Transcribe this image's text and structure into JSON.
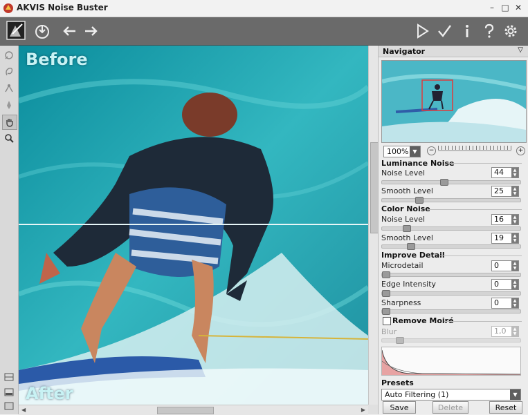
{
  "window": {
    "title": "AKVIS Noise Buster",
    "minimize": "–",
    "maximize": "□",
    "close": "✕"
  },
  "toolbar": {
    "left_icons": [
      "photo-icon",
      "save-icon",
      "undo-arrow-icon",
      "redo-arrow-icon"
    ],
    "right_icons": [
      "run-icon",
      "apply-check-icon",
      "info-icon",
      "help-icon",
      "settings-gear-icon"
    ]
  },
  "tools": [
    "crop-tool-icon",
    "lasso-tool-icon",
    "heal-tool-icon",
    "brush-tool-icon",
    "hand-tool-icon",
    "zoom-tool-icon"
  ],
  "canvas": {
    "before_label": "Before",
    "after_label": "After"
  },
  "navigator": {
    "title": "Navigator",
    "zoom": "100%"
  },
  "luminance": {
    "title": "Luminance Noise",
    "noise_level_label": "Noise Level",
    "noise_level": "44",
    "noise_level_frac": 0.44,
    "smooth_level_label": "Smooth Level",
    "smooth_level": "25",
    "smooth_level_frac": 0.25
  },
  "color": {
    "title": "Color Noise",
    "noise_level_label": "Noise Level",
    "noise_level": "16",
    "noise_level_frac": 0.16,
    "smooth_level_label": "Smooth Level",
    "smooth_level": "19",
    "smooth_level_frac": 0.19
  },
  "detail": {
    "title": "Improve Detail",
    "microdetail_label": "Microdetail",
    "microdetail": "0",
    "edge_label": "Edge Intensity",
    "edge": "0",
    "sharpness_label": "Sharpness",
    "sharpness": "0"
  },
  "moire": {
    "title": "Remove Moiré",
    "blur_label": "Blur",
    "blur": "1,0"
  },
  "presets": {
    "title": "Presets",
    "selected": "Auto Filtering (1)",
    "save": "Save",
    "delete": "Delete",
    "reset": "Reset"
  }
}
